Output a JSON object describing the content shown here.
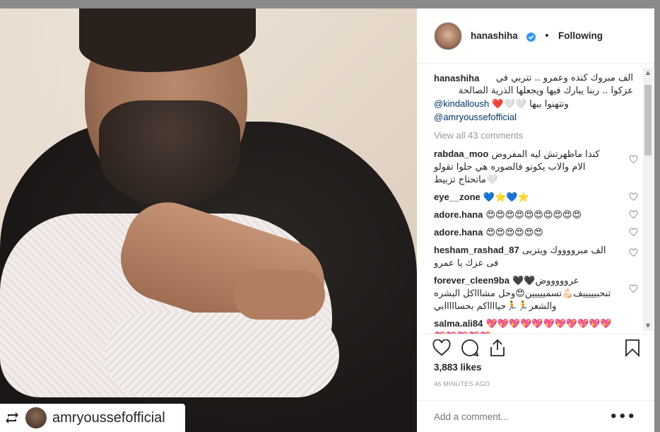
{
  "photo": {
    "repost_username": "amryoussefofficial"
  },
  "post": {
    "username": "hanashiha",
    "separator": "•",
    "follow_status": "Following",
    "caption_username": "hanashiha",
    "caption_lines": [
      "الف مبروك كنده وعمرو .. تتربي في",
      "عزكوا .. ربنا يبارك فيها ويجعلها الذرية الصالحة",
      "وتتهنوا بيها"
    ],
    "caption_emojis": "❤️🤍🤍",
    "mention_1": "@kindalloush",
    "mention_2": "@amryoussefofficial",
    "view_all_comments": "View all 43 comments",
    "comments": [
      {
        "username": "rabdaa_moo",
        "text": "كندا ماظهرتش ليه المفروض الام والاب يكونو فالصوره هي حلوا تقولو ماتحتاج تزبيط🤍"
      },
      {
        "username": "eye__zone",
        "text": "💙⭐💙⭐"
      },
      {
        "username": "adore.hana",
        "text": "😍😍😍😍😍😍😍😍😍😍"
      },
      {
        "username": "adore.hana",
        "text": "😍😍😍😍😍😍"
      },
      {
        "username": "hesham_rashad_87",
        "text": "الف مبرووووك ويتربى فى عزك يا عمرو"
      },
      {
        "username": "forever_cleen9ba",
        "text": "🖤🖤عروووووض تنحبيييييف💪🏻تسمييييين😍وحل مشاااكل البشره والشعر🏃🏃حيااااكم بحسااااابي"
      },
      {
        "username": "salma.ali84",
        "text": "💖💖💖💖💖💖💖💖💖💖💖💖💖💖💖💖"
      }
    ],
    "likes": "3,883 likes",
    "timestamp": "46 MINUTES AGO",
    "add_comment_placeholder": "Add a comment...",
    "more_options": "•••"
  },
  "colors": {
    "text": "#262626",
    "muted": "#999999",
    "mention": "#003569",
    "verified": "#3897f0",
    "background": "#8a8a8a"
  }
}
